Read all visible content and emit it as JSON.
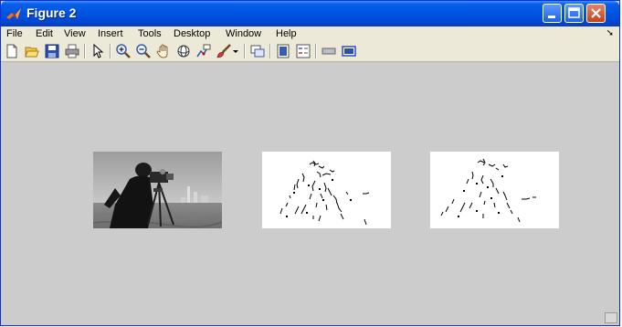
{
  "window": {
    "title": "Figure 2",
    "accent": "#0055e5",
    "canvas_color": "#cccccc"
  },
  "menu": {
    "items": [
      "File",
      "Edit",
      "View",
      "Insert",
      "Tools",
      "Desktop",
      "Window",
      "Help"
    ],
    "overflow_arrow": "➘"
  },
  "toolbar": {
    "icons": [
      "new-figure-icon",
      "open-file-icon",
      "save-icon",
      "print-icon",
      "edit-plot-arrow-icon",
      "zoom-in-icon",
      "zoom-out-icon",
      "pan-hand-icon",
      "rotate-3d-icon",
      "data-cursor-icon",
      "brush-icon",
      "brush-dropdown-icon",
      "link-plot-icon",
      "colorbar-icon",
      "legend-icon",
      "hide-plot-tools-icon",
      "show-plot-tools-icon"
    ]
  },
  "figure": {
    "axes": [
      {
        "kind": "grayscale-photo",
        "subject": "cameraman"
      },
      {
        "kind": "edge-map"
      },
      {
        "kind": "edge-map"
      }
    ]
  }
}
